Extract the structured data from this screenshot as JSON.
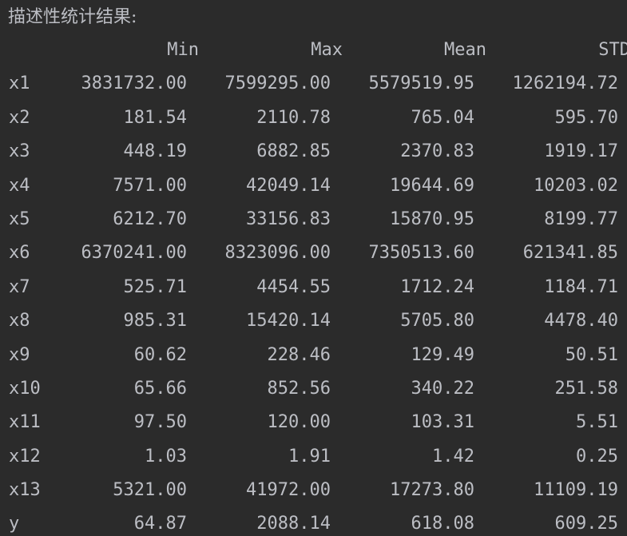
{
  "title": "描述性统计结果:",
  "columns": [
    "Min",
    "Max",
    "Mean",
    "STD"
  ],
  "rows": [
    {
      "label": "x1",
      "min": "3831732.00",
      "max": "7599295.00",
      "mean": "5579519.95",
      "std": "1262194.72"
    },
    {
      "label": "x2",
      "min": "181.54",
      "max": "2110.78",
      "mean": "765.04",
      "std": "595.70"
    },
    {
      "label": "x3",
      "min": "448.19",
      "max": "6882.85",
      "mean": "2370.83",
      "std": "1919.17"
    },
    {
      "label": "x4",
      "min": "7571.00",
      "max": "42049.14",
      "mean": "19644.69",
      "std": "10203.02"
    },
    {
      "label": "x5",
      "min": "6212.70",
      "max": "33156.83",
      "mean": "15870.95",
      "std": "8199.77"
    },
    {
      "label": "x6",
      "min": "6370241.00",
      "max": "8323096.00",
      "mean": "7350513.60",
      "std": "621341.85"
    },
    {
      "label": "x7",
      "min": "525.71",
      "max": "4454.55",
      "mean": "1712.24",
      "std": "1184.71"
    },
    {
      "label": "x8",
      "min": "985.31",
      "max": "15420.14",
      "mean": "5705.80",
      "std": "4478.40"
    },
    {
      "label": "x9",
      "min": "60.62",
      "max": "228.46",
      "mean": "129.49",
      "std": "50.51"
    },
    {
      "label": "x10",
      "min": "65.66",
      "max": "852.56",
      "mean": "340.22",
      "std": "251.58"
    },
    {
      "label": "x11",
      "min": "97.50",
      "max": "120.00",
      "mean": "103.31",
      "std": "5.51"
    },
    {
      "label": "x12",
      "min": "1.03",
      "max": "1.91",
      "mean": "1.42",
      "std": "0.25"
    },
    {
      "label": "x13",
      "min": "5321.00",
      "max": "41972.00",
      "mean": "17273.80",
      "std": "11109.19"
    },
    {
      "label": "y",
      "min": "64.87",
      "max": "2088.14",
      "mean": "618.08",
      "std": "609.25"
    }
  ],
  "colors": {
    "background": "#2b2b2b",
    "text": "#bcbec4"
  }
}
